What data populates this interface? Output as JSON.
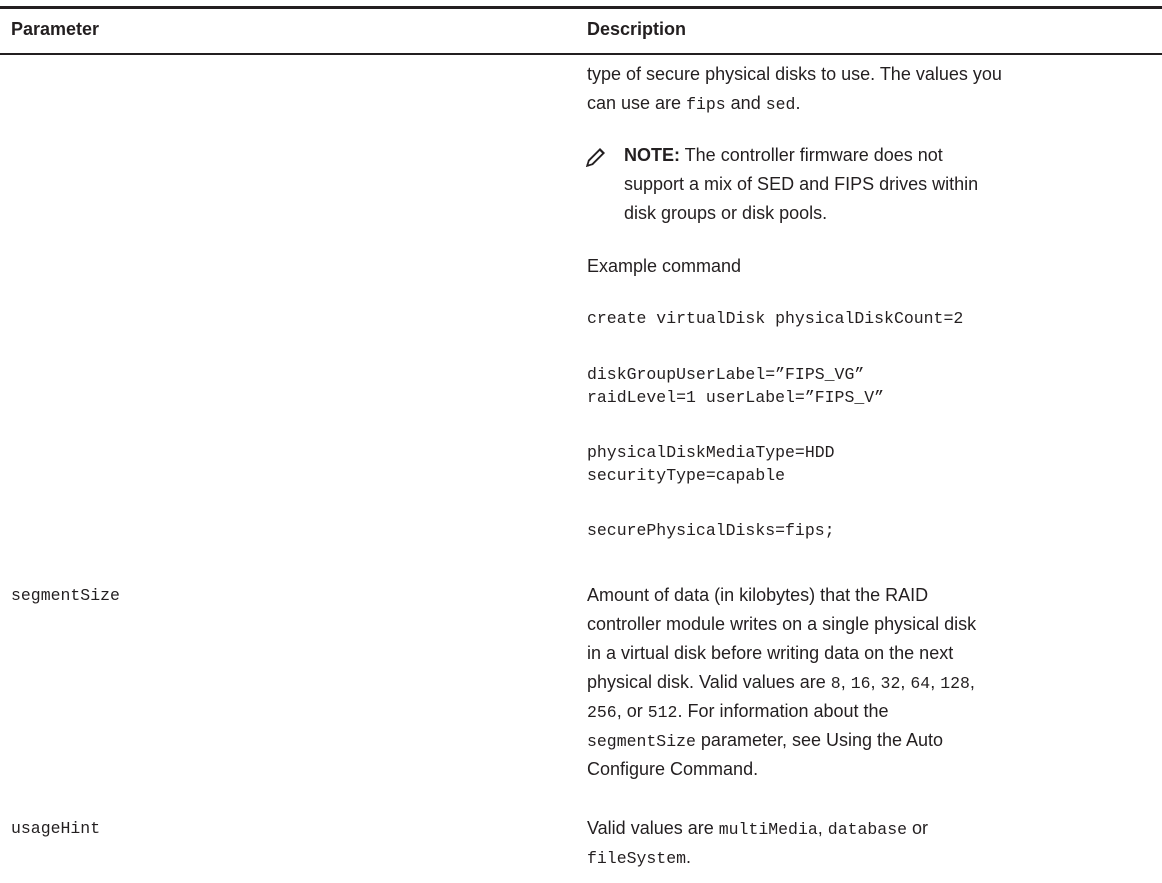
{
  "header": {
    "parameter": "Parameter",
    "description": "Description"
  },
  "secure_physical_disks": {
    "desc_line1": "type of secure physical disks to use. The values you",
    "desc_line2_pre": "can use are ",
    "desc_val1": "fips",
    "desc_mid": " and ",
    "desc_val2": "sed",
    "desc_end": ".",
    "note_label": "NOTE:",
    "note_line1": " The controller firmware does not",
    "note_line2": "support a mix of SED and FIPS drives within",
    "note_line3": "disk groups or disk pools.",
    "note_icon": "pencil-note-icon",
    "example_label": "Example command",
    "code1": "create virtualDisk physicalDiskCount=2",
    "code2": "diskGroupUserLabel=”FIPS_VG”\nraidLevel=1 userLabel=”FIPS_V”",
    "code3": "physicalDiskMediaType=HDD\nsecurityType=capable",
    "code4": "securePhysicalDisks=fips;"
  },
  "segment_size": {
    "name": "segmentSize",
    "line1": "Amount of data (in kilobytes) that the RAID",
    "line2": "controller module writes on a single physical disk",
    "line3": "in a virtual disk before writing data on the next",
    "line4_pre": "physical disk. Valid values are ",
    "v8": "8",
    "v16": "16",
    "v32": "32",
    "v64": "64",
    "v128": "128",
    "v256": "256",
    "line5_mid": ", or ",
    "v512": "512",
    "line5_post": ". For information about the",
    "line6_code": "segmentSize",
    "line6_post": " parameter, see Using the Auto",
    "line7": "Configure Command.",
    "sep": ", "
  },
  "usage_hint": {
    "name": "usageHint",
    "pre": "Valid values are ",
    "v1": "multiMedia",
    "sep1": ", ",
    "v2": "database",
    "sep2": " or",
    "v3": "fileSystem",
    "end": "."
  }
}
